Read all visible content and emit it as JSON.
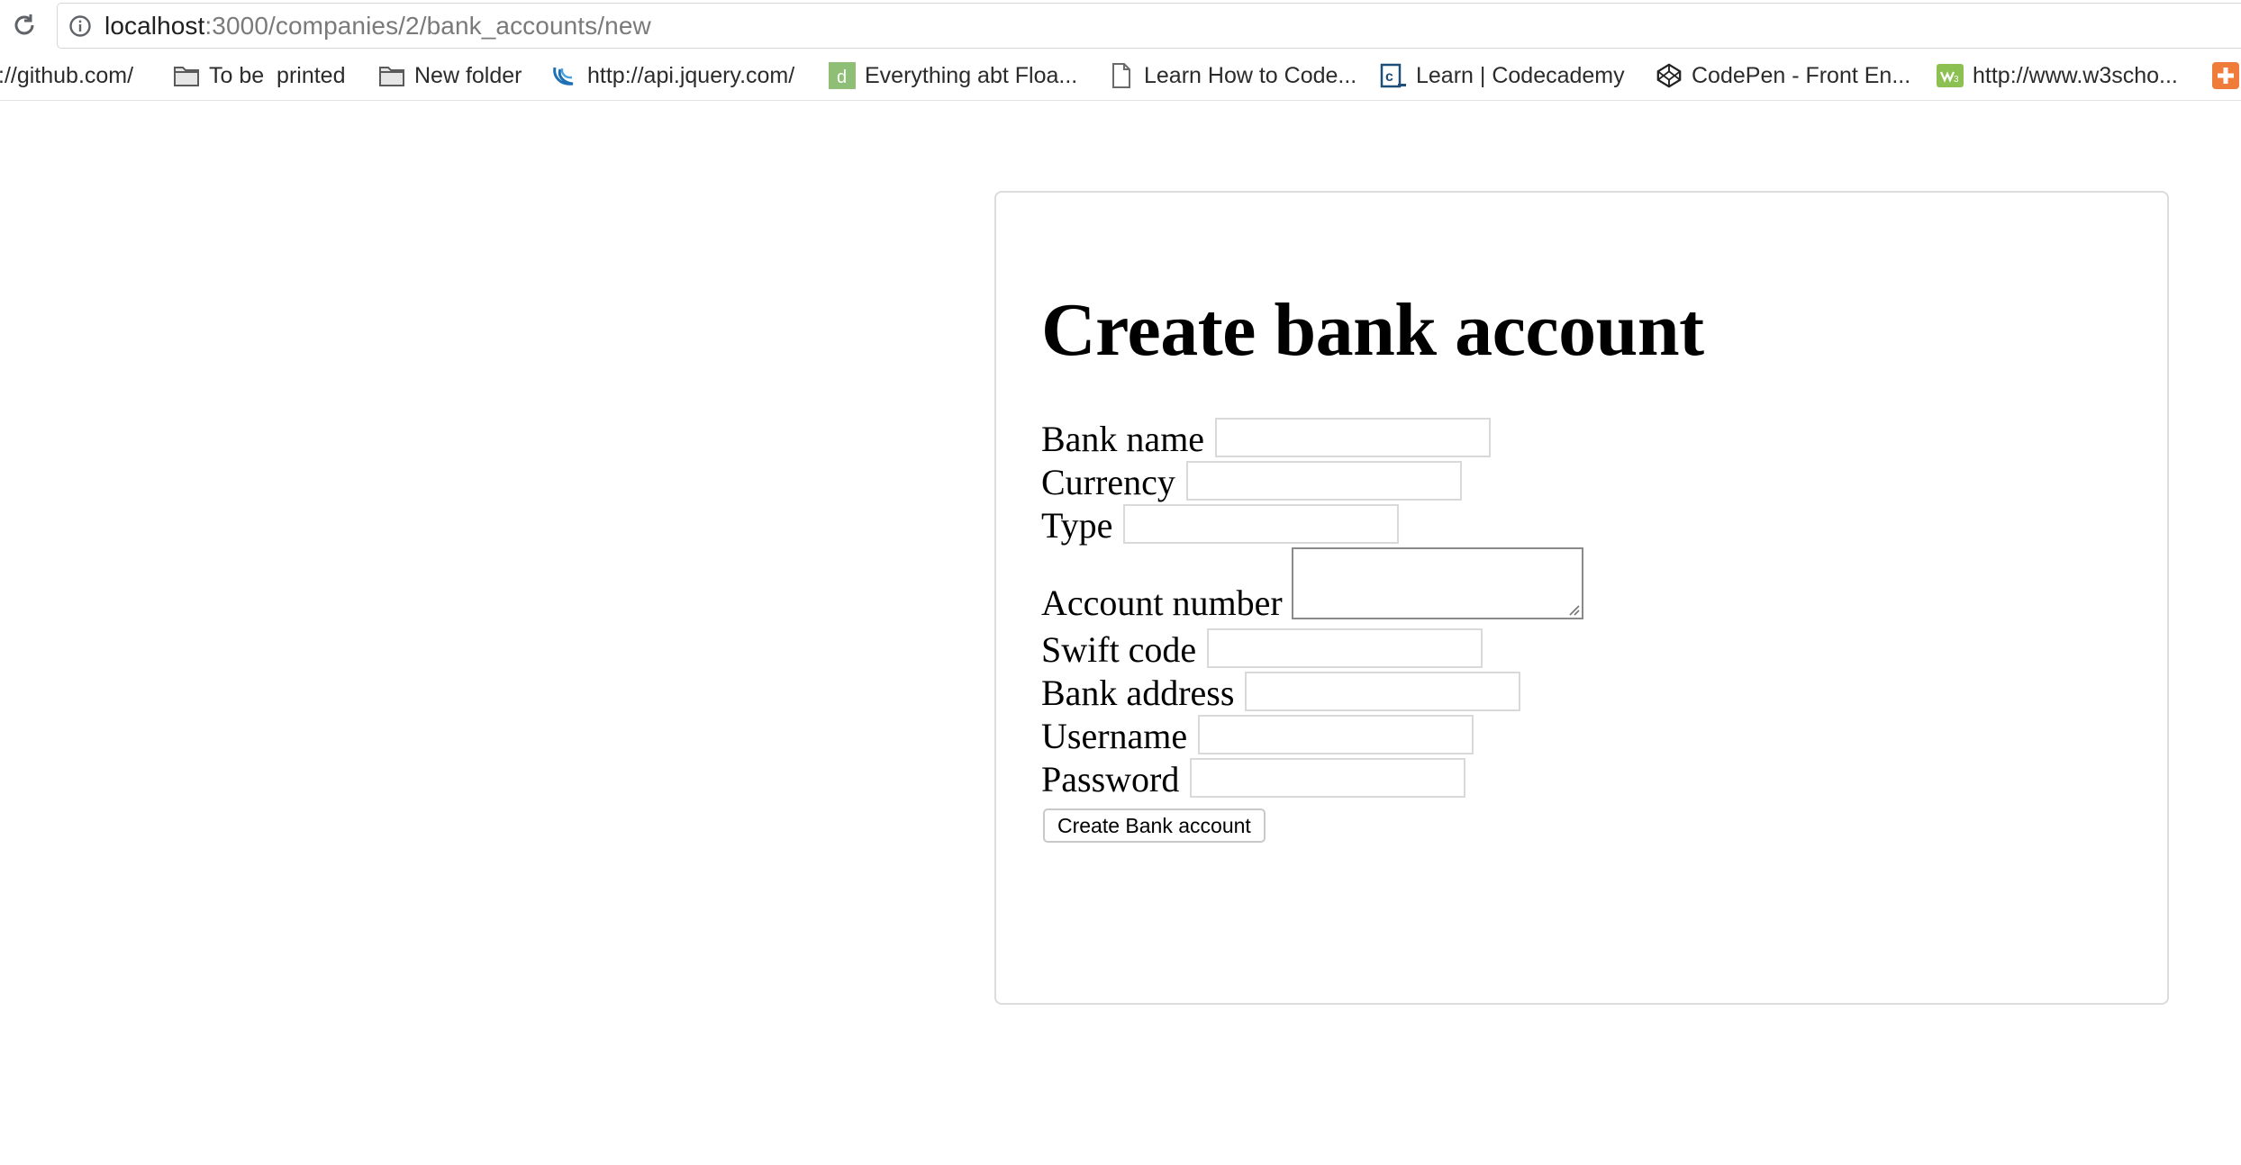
{
  "browser": {
    "url_host": "localhost",
    "url_rest": ":3000/companies/2/bank_accounts/new",
    "bookmarks": [
      {
        "label": "://github.com/",
        "icon": "none"
      },
      {
        "label": "To be  printed",
        "icon": "folder-icon"
      },
      {
        "label": "New folder",
        "icon": "folder-icon"
      },
      {
        "label": "http://api.jquery.com/",
        "icon": "jquery-icon"
      },
      {
        "label": "Everything abt Floa...",
        "icon": "d-logo-icon"
      },
      {
        "label": "Learn How to Code...",
        "icon": "page-icon"
      },
      {
        "label": "Learn | Codecademy",
        "icon": "codecademy-icon"
      },
      {
        "label": "CodePen - Front En...",
        "icon": "codepen-icon"
      },
      {
        "label": "http://www.w3scho...",
        "icon": "w3schools-icon"
      }
    ]
  },
  "page": {
    "title": "Create bank account",
    "fields": [
      {
        "label": "Bank name",
        "type": "text",
        "value": ""
      },
      {
        "label": "Currency",
        "type": "text",
        "value": ""
      },
      {
        "label": "Type",
        "type": "text",
        "value": ""
      },
      {
        "label": "Account number",
        "type": "textarea",
        "value": ""
      },
      {
        "label": "Swift code",
        "type": "text",
        "value": ""
      },
      {
        "label": "Bank address",
        "type": "text",
        "value": ""
      },
      {
        "label": "Username",
        "type": "text",
        "value": ""
      },
      {
        "label": "Password",
        "type": "text",
        "value": ""
      }
    ],
    "submit_label": "Create Bank account"
  },
  "colors": {
    "card_border": "#dcdcdc",
    "input_border": "#d9d9d9",
    "textarea_border": "#8a8a8a",
    "url_host": "#202020",
    "url_path": "#7a7a7a"
  }
}
